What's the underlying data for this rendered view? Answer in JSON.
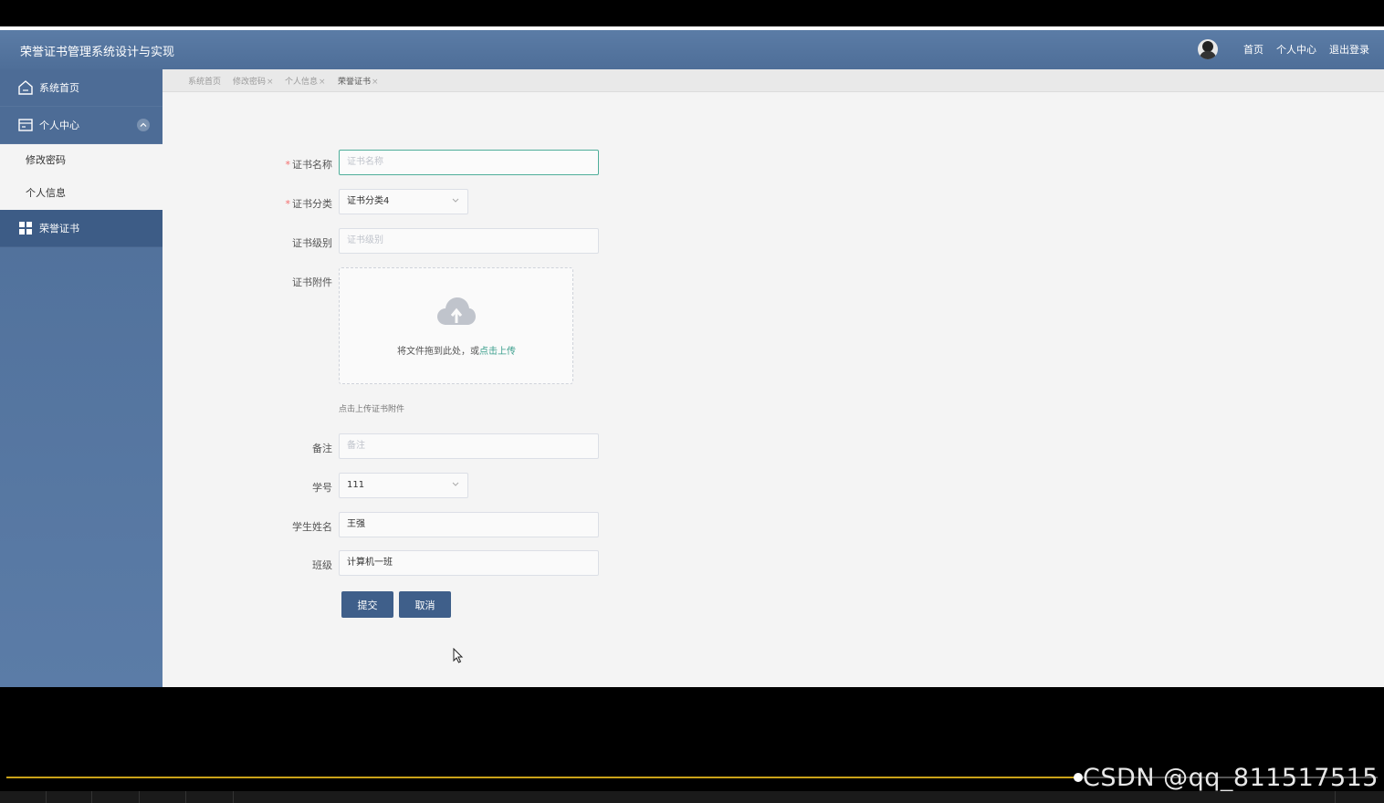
{
  "header": {
    "app_title": "荣誉证书管理系统设计与实现",
    "links": [
      "首页",
      "个人中心",
      "退出登录"
    ]
  },
  "sidebar": {
    "home": "系统首页",
    "personal_center": "个人中心",
    "sub_items": [
      "修改密码",
      "个人信息"
    ],
    "honor_cert": "荣誉证书"
  },
  "tabs": [
    {
      "label": "系统首页",
      "closable": false
    },
    {
      "label": "修改密码",
      "closable": true
    },
    {
      "label": "个人信息",
      "closable": true
    },
    {
      "label": "荣誉证书",
      "closable": true
    }
  ],
  "form": {
    "cert_name": {
      "label": "证书名称",
      "required": true,
      "placeholder": "证书名称",
      "value": ""
    },
    "cert_category": {
      "label": "证书分类",
      "required": true,
      "value": "证书分类4"
    },
    "cert_level": {
      "label": "证书级别",
      "placeholder": "证书级别",
      "value": ""
    },
    "cert_attachment": {
      "label": "证书附件",
      "upload_text": "将文件拖到此处，或",
      "upload_link": "点击上传",
      "tip": "点击上传证书附件"
    },
    "remark": {
      "label": "备注",
      "placeholder": "备注",
      "value": ""
    },
    "student_no": {
      "label": "学号",
      "value": "111"
    },
    "student_name": {
      "label": "学生姓名",
      "value": "王强"
    },
    "class_name": {
      "label": "班级",
      "value": "计算机一班"
    },
    "submit": "提交",
    "cancel": "取消"
  },
  "watermark": "CSDN @qq_811517515",
  "colors": {
    "header": "#4e6e98",
    "sidebar_active": "#3d5c86",
    "button": "#3f5f8a",
    "upload_link": "#3a9e8c",
    "required": "#f56c6c",
    "progress": "#c9a219"
  }
}
